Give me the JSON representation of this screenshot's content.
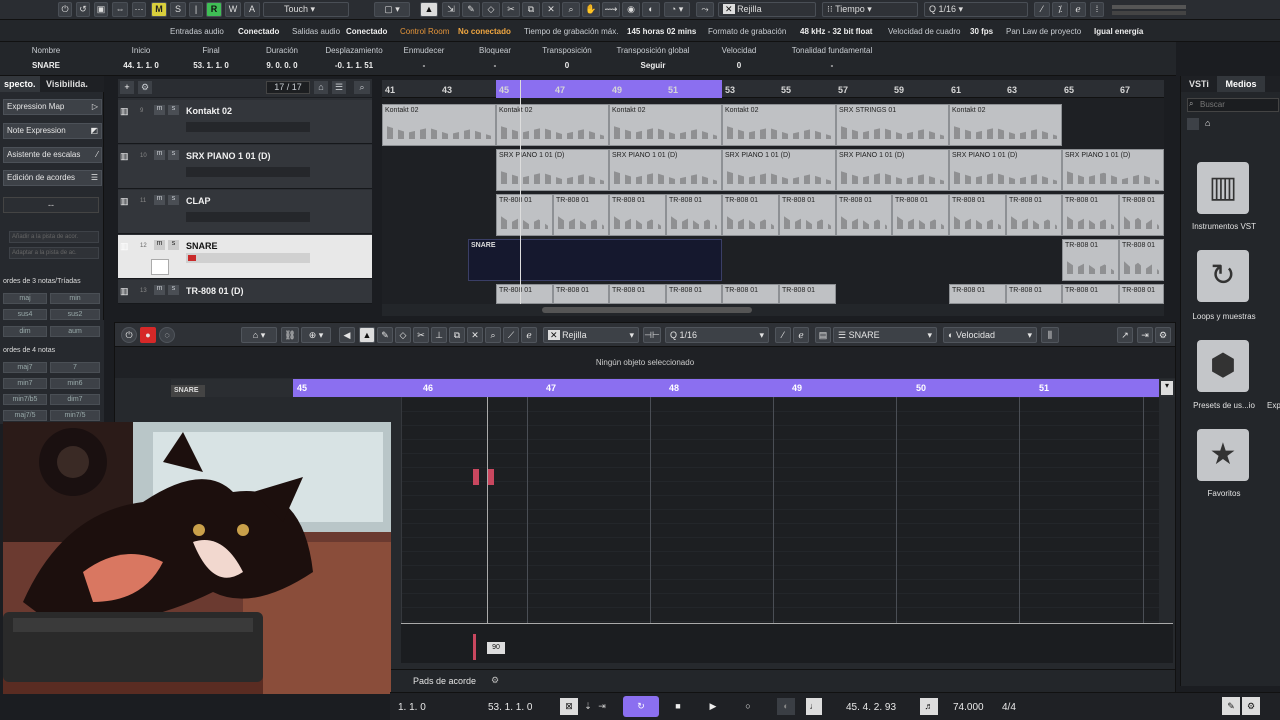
{
  "toolbar": {
    "m": "M",
    "s": "S",
    "r": "R",
    "w": "W",
    "a": "A",
    "automation_mode": "Touch",
    "snap": "Rejilla",
    "time": "Tiempo",
    "quantize": "1/16"
  },
  "status": {
    "in_label": "Entradas audio",
    "in_val": "Conectado",
    "out_label": "Salidas audio",
    "out_val": "Conectado",
    "cr_label": "Control Room",
    "cr_val": "No conectado",
    "rec_label": "Tiempo de grabación máx.",
    "rec_val": "145 horas 02 mins",
    "fmt_label": "Formato de grabación",
    "fmt_val": "48 kHz - 32 bit float",
    "fps_label": "Velocidad de cuadro",
    "fps_val": "30 fps",
    "pan_label": "Pan Law de proyecto",
    "pan_val": "Igual energía"
  },
  "info": [
    {
      "label": "Nombre",
      "value": "SNARE"
    },
    {
      "label": "Inicio",
      "value": "44. 1. 1.   0"
    },
    {
      "label": "Final",
      "value": "53. 1. 1.   0"
    },
    {
      "label": "Duración",
      "value": "9. 0. 0.   0"
    },
    {
      "label": "Desplazamiento",
      "value": "-0. 1. 1. 51"
    },
    {
      "label": "Enmudecer",
      "value": "-"
    },
    {
      "label": "Bloquear",
      "value": "-"
    },
    {
      "label": "Transposición",
      "value": "0"
    },
    {
      "label": "Transposición global",
      "value": "Seguir"
    },
    {
      "label": "Velocidad",
      "value": "0"
    },
    {
      "label": "Tonalidad fundamental",
      "value": "-"
    }
  ],
  "inspector": {
    "tab1": "specto.",
    "tab2": "Visibilida.",
    "items": [
      "Expression Map",
      "Note Expression",
      "Asistente de escalas",
      "Edición de acordes"
    ],
    "dash": "--",
    "add1": "Añadir a la pista de acor.",
    "add2": "Adaptar a la pista de ac.",
    "h3": "ordes de 3 notas/Tríadas",
    "h4": "ordes de 4 notas",
    "chords3": [
      "maj",
      "min",
      "sus4",
      "sus2",
      "dim",
      "aum"
    ],
    "chords4": [
      "maj7",
      "7",
      "min7",
      "min6",
      "min7/b5",
      "dim7",
      "maj7/5",
      "min7/5"
    ]
  },
  "tracklist": {
    "count": "17 / 17",
    "tracks": [
      {
        "num": "9",
        "name": "Kontakt 02"
      },
      {
        "num": "10",
        "name": "SRX PIANO 1 01 (D)"
      },
      {
        "num": "11",
        "name": "CLAP"
      },
      {
        "num": "12",
        "name": "SNARE"
      },
      {
        "num": "13",
        "name": "TR-808 01 (D)"
      }
    ]
  },
  "ruler": [
    "41",
    "43",
    "45",
    "47",
    "49",
    "51",
    "53",
    "55",
    "57",
    "59",
    "61",
    "63",
    "65",
    "67"
  ],
  "parts": {
    "kontakt": "Kontakt 02",
    "strings": "SRX STRINGS 01",
    "piano": "SRX PIANO 1 01 (D)",
    "tr808": "TR-808 01",
    "snare": "SNARE"
  },
  "editor": {
    "snap": "Rejilla",
    "quant": "1/16",
    "track": "SNARE",
    "lane": "Velocidad",
    "status": "Ningún objeto seleccionado",
    "part": "SNARE",
    "bars": [
      "45",
      "46",
      "47",
      "48",
      "49",
      "50",
      "51"
    ],
    "velocity": "90",
    "chord_pads": "Pads de acorde"
  },
  "media": {
    "tab1": "VSTi",
    "tab2": "Medios",
    "search": "Buscar",
    "items": [
      "Instrumentos VST",
      "Loops y muestras",
      "Presets de us...io",
      "Favoritos"
    ],
    "extra": "Exp"
  },
  "transport": {
    "left": "1. 1. 0",
    "right": "53. 1. 1.   0",
    "pos": "45. 4. 2. 93",
    "tempo": "74.000",
    "sig": "4/4"
  }
}
